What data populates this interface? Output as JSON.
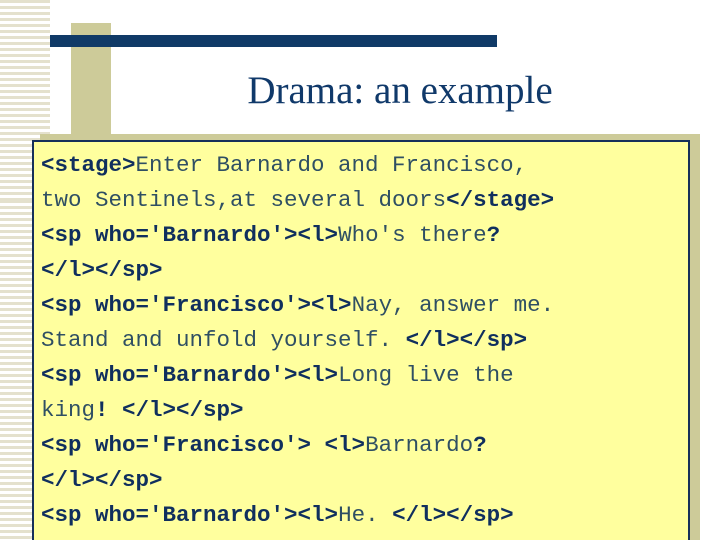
{
  "slide": {
    "title": "Drama: an example",
    "accent_navy": "#103a67",
    "accent_tan": "#cdcb99",
    "code_background": "#ffff9e",
    "code_border": "#16305a"
  },
  "code_block": {
    "lines": [
      [
        {
          "text": "<stage>",
          "bold": true
        },
        {
          "text": "Enter Barnardo and Francisco,",
          "bold": false
        }
      ],
      [
        {
          "text": "two Sentinels,at several doors",
          "bold": false
        },
        {
          "text": "</stage>",
          "bold": true
        }
      ],
      [
        {
          "text": "<sp who='Barnardo'><l>",
          "bold": true
        },
        {
          "text": "Who's there",
          "bold": false
        },
        {
          "text": "?",
          "bold": true
        }
      ],
      [
        {
          "text": "</l></sp>",
          "bold": true
        }
      ],
      [
        {
          "text": "<sp who='Francisco'><l>",
          "bold": true
        },
        {
          "text": "Nay, answer me.",
          "bold": false
        }
      ],
      [
        {
          "text": "Stand and unfold yourself. ",
          "bold": false
        },
        {
          "text": "</l></sp>",
          "bold": true
        }
      ],
      [
        {
          "text": "<sp who='Barnardo'><l>",
          "bold": true
        },
        {
          "text": "Long live the",
          "bold": false
        }
      ],
      [
        {
          "text": "king",
          "bold": false
        },
        {
          "text": "! ",
          "bold": true
        },
        {
          "text": "</l></sp>",
          "bold": true
        }
      ],
      [
        {
          "text": "<sp who='Francisco'> <l>",
          "bold": true
        },
        {
          "text": "Barnardo",
          "bold": false
        },
        {
          "text": "?",
          "bold": true
        }
      ],
      [
        {
          "text": "</l></sp>",
          "bold": true
        }
      ],
      [
        {
          "text": "<sp who='Barnardo'><l>",
          "bold": true
        },
        {
          "text": "He. ",
          "bold": false
        },
        {
          "text": "</l></sp>",
          "bold": true
        }
      ]
    ]
  }
}
